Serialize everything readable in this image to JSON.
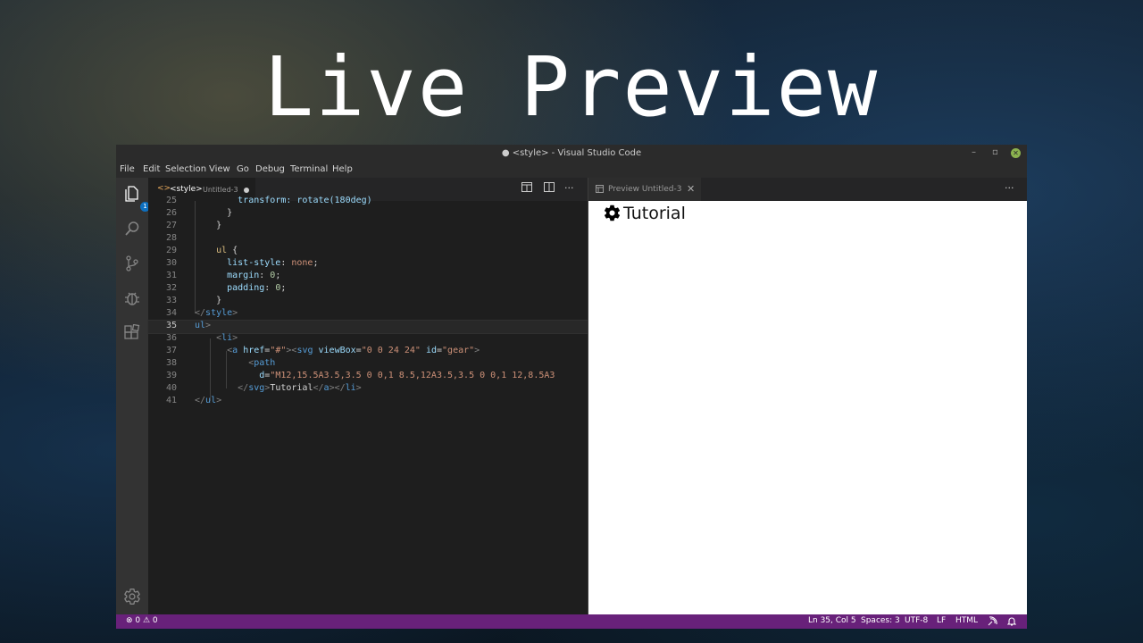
{
  "hero": {
    "title": "Live Preview"
  },
  "window": {
    "title": "● <style> - Visual Studio Code",
    "min": "–",
    "max": "▫",
    "close": "✕"
  },
  "menu": [
    "File",
    "Edit",
    "Selection",
    "View",
    "Go",
    "Debug",
    "Terminal",
    "Help"
  ],
  "activity": {
    "explorer_badge": "1"
  },
  "editor_tab": {
    "icon": "<>",
    "name": "<style>",
    "description": "Untitled-3",
    "modified": true
  },
  "editor_actions": {
    "more": "···"
  },
  "code_lines": [
    {
      "n": "25",
      "segs": [
        [
          "c-prop",
          "        transform: rotate(180deg)"
        ]
      ]
    },
    {
      "n": "26",
      "segs": [
        [
          "c-txt",
          "      }"
        ]
      ]
    },
    {
      "n": "27",
      "segs": [
        [
          "c-txt",
          "    }"
        ]
      ]
    },
    {
      "n": "28",
      "segs": [
        [
          "c-txt",
          ""
        ]
      ]
    },
    {
      "n": "29",
      "segs": [
        [
          "c-sel",
          "    ul"
        ],
        [
          "c-txt",
          " {"
        ]
      ]
    },
    {
      "n": "30",
      "segs": [
        [
          "c-prop",
          "      list-style"
        ],
        [
          "c-txt",
          ": "
        ],
        [
          "c-str",
          "none"
        ],
        [
          "c-txt",
          ";"
        ]
      ]
    },
    {
      "n": "31",
      "segs": [
        [
          "c-prop",
          "      margin"
        ],
        [
          "c-txt",
          ": "
        ],
        [
          "c-num",
          "0"
        ],
        [
          "c-txt",
          ";"
        ]
      ]
    },
    {
      "n": "32",
      "segs": [
        [
          "c-prop",
          "      padding"
        ],
        [
          "c-txt",
          ": "
        ],
        [
          "c-num",
          "0"
        ],
        [
          "c-txt",
          ";"
        ]
      ]
    },
    {
      "n": "33",
      "segs": [
        [
          "c-txt",
          "    }"
        ]
      ]
    },
    {
      "n": "34",
      "segs": [
        [
          "c-br",
          "</"
        ],
        [
          "c-tag",
          "style"
        ],
        [
          "c-br",
          ">"
        ]
      ]
    },
    {
      "n": "35",
      "segs": [
        [
          "c-tag",
          "ul"
        ],
        [
          "c-br",
          ">"
        ]
      ]
    },
    {
      "n": "36",
      "segs": [
        [
          "c-br",
          "    <"
        ],
        [
          "c-tag",
          "li"
        ],
        [
          "c-br",
          ">"
        ]
      ]
    },
    {
      "n": "37",
      "segs": [
        [
          "c-br",
          "      <"
        ],
        [
          "c-tag",
          "a"
        ],
        [
          "c-attr",
          " href"
        ],
        [
          "c-txt",
          "="
        ],
        [
          "c-str",
          "\"#\""
        ],
        [
          "c-br",
          "><"
        ],
        [
          "c-tag",
          "svg"
        ],
        [
          "c-attr",
          " viewBox"
        ],
        [
          "c-txt",
          "="
        ],
        [
          "c-str",
          "\"0 0 24 24\""
        ],
        [
          "c-attr",
          " id"
        ],
        [
          "c-txt",
          "="
        ],
        [
          "c-str",
          "\"gear\""
        ],
        [
          "c-br",
          ">"
        ]
      ]
    },
    {
      "n": "38",
      "segs": [
        [
          "c-br",
          "          <"
        ],
        [
          "c-tag",
          "path"
        ]
      ]
    },
    {
      "n": "39",
      "segs": [
        [
          "c-attr",
          "            d"
        ],
        [
          "c-txt",
          "="
        ],
        [
          "c-str",
          "\"M12,15.5A3.5,3.5 0 0,1 8.5,12A3.5,3.5 0 0,1 12,8.5A3"
        ]
      ]
    },
    {
      "n": "40",
      "segs": [
        [
          "c-br",
          "        </"
        ],
        [
          "c-tag",
          "svg"
        ],
        [
          "c-br",
          ">"
        ],
        [
          "c-txt",
          "Tutorial"
        ],
        [
          "c-br",
          "</"
        ],
        [
          "c-tag",
          "a"
        ],
        [
          "c-br",
          "></"
        ],
        [
          "c-tag",
          "li"
        ],
        [
          "c-br",
          ">"
        ]
      ]
    },
    {
      "n": "41",
      "segs": [
        [
          "c-br",
          "</"
        ],
        [
          "c-tag",
          "ul"
        ],
        [
          "c-br",
          ">"
        ]
      ]
    }
  ],
  "preview_tab": {
    "label": "Preview Untitled-3",
    "close": "✕",
    "more": "···"
  },
  "preview": {
    "link_text": "Tutorial"
  },
  "status": {
    "problems": "⊗ 0 ⚠ 0",
    "position": "Ln 35, Col 5",
    "spaces": "Spaces: 3",
    "encoding": "UTF-8",
    "eol": "LF",
    "language": "HTML"
  },
  "colors": {
    "statusbar": "#68217a",
    "editor_bg": "#1e1e1e",
    "accent_badge": "#0e70c0"
  }
}
